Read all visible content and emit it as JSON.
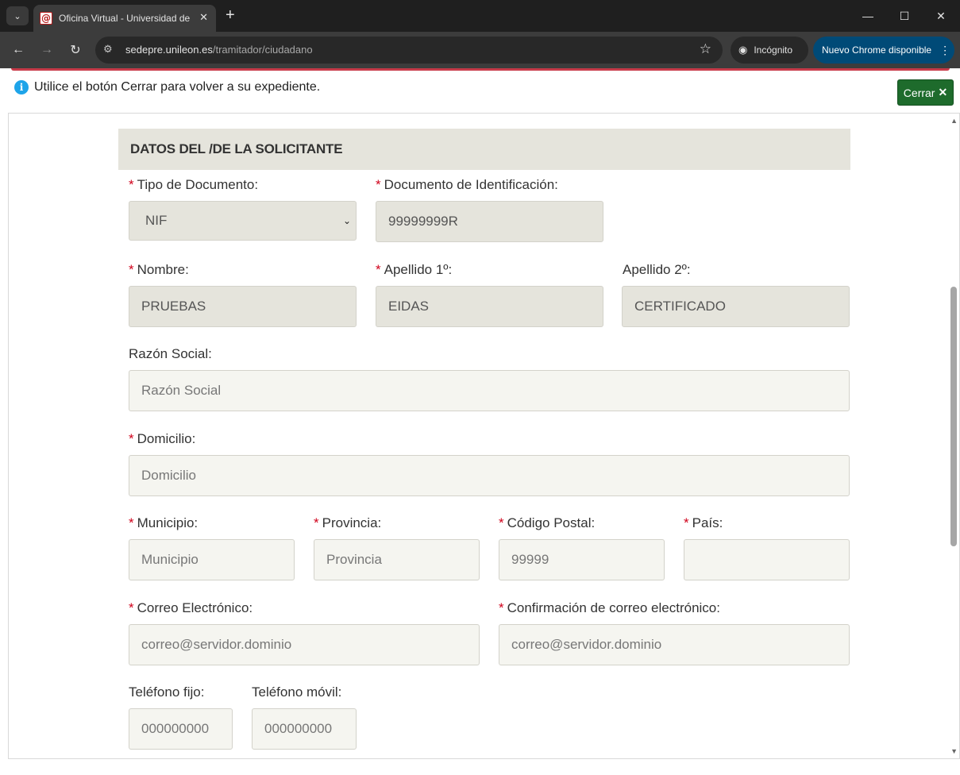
{
  "browser": {
    "tab_title": "Oficina Virtual - Universidad de",
    "url_host": "sedepre.unileon.es",
    "url_path": "/tramitador/ciudadano",
    "incognito_label": "Incógnito",
    "update_label": "Nuevo Chrome disponible"
  },
  "notice": {
    "text": "Utilice el botón Cerrar para volver a su expediente.",
    "close_label": "Cerrar"
  },
  "form": {
    "section_title": "DATOS DEL /DE LA SOLICITANTE",
    "tipo_documento": {
      "label": "Tipo de Documento:",
      "value": "NIF"
    },
    "documento": {
      "label": "Documento de Identificación:",
      "value": "99999999R"
    },
    "nombre": {
      "label": "Nombre:",
      "value": "PRUEBAS"
    },
    "apellido1": {
      "label": "Apellido 1º:",
      "value": "EIDAS"
    },
    "apellido2": {
      "label": "Apellido 2º:",
      "value": "CERTIFICADO"
    },
    "razon_social": {
      "label": "Razón Social:",
      "placeholder": "Razón Social"
    },
    "domicilio": {
      "label": "Domicilio:",
      "placeholder": "Domicilio"
    },
    "municipio": {
      "label": "Municipio:",
      "placeholder": "Municipio"
    },
    "provincia": {
      "label": "Provincia:",
      "placeholder": "Provincia"
    },
    "codigo_postal": {
      "label": "Código Postal:",
      "placeholder": "99999"
    },
    "pais": {
      "label": "País:",
      "placeholder": ""
    },
    "correo": {
      "label": "Correo Electrónico:",
      "placeholder": "correo@servidor.dominio"
    },
    "correo_confirm": {
      "label": "Confirmación de correo electrónico:",
      "placeholder": "correo@servidor.dominio"
    },
    "telefono_fijo": {
      "label": "Teléfono fijo:",
      "placeholder": "000000000"
    },
    "telefono_movil": {
      "label": "Teléfono móvil:",
      "placeholder": "000000000"
    }
  }
}
